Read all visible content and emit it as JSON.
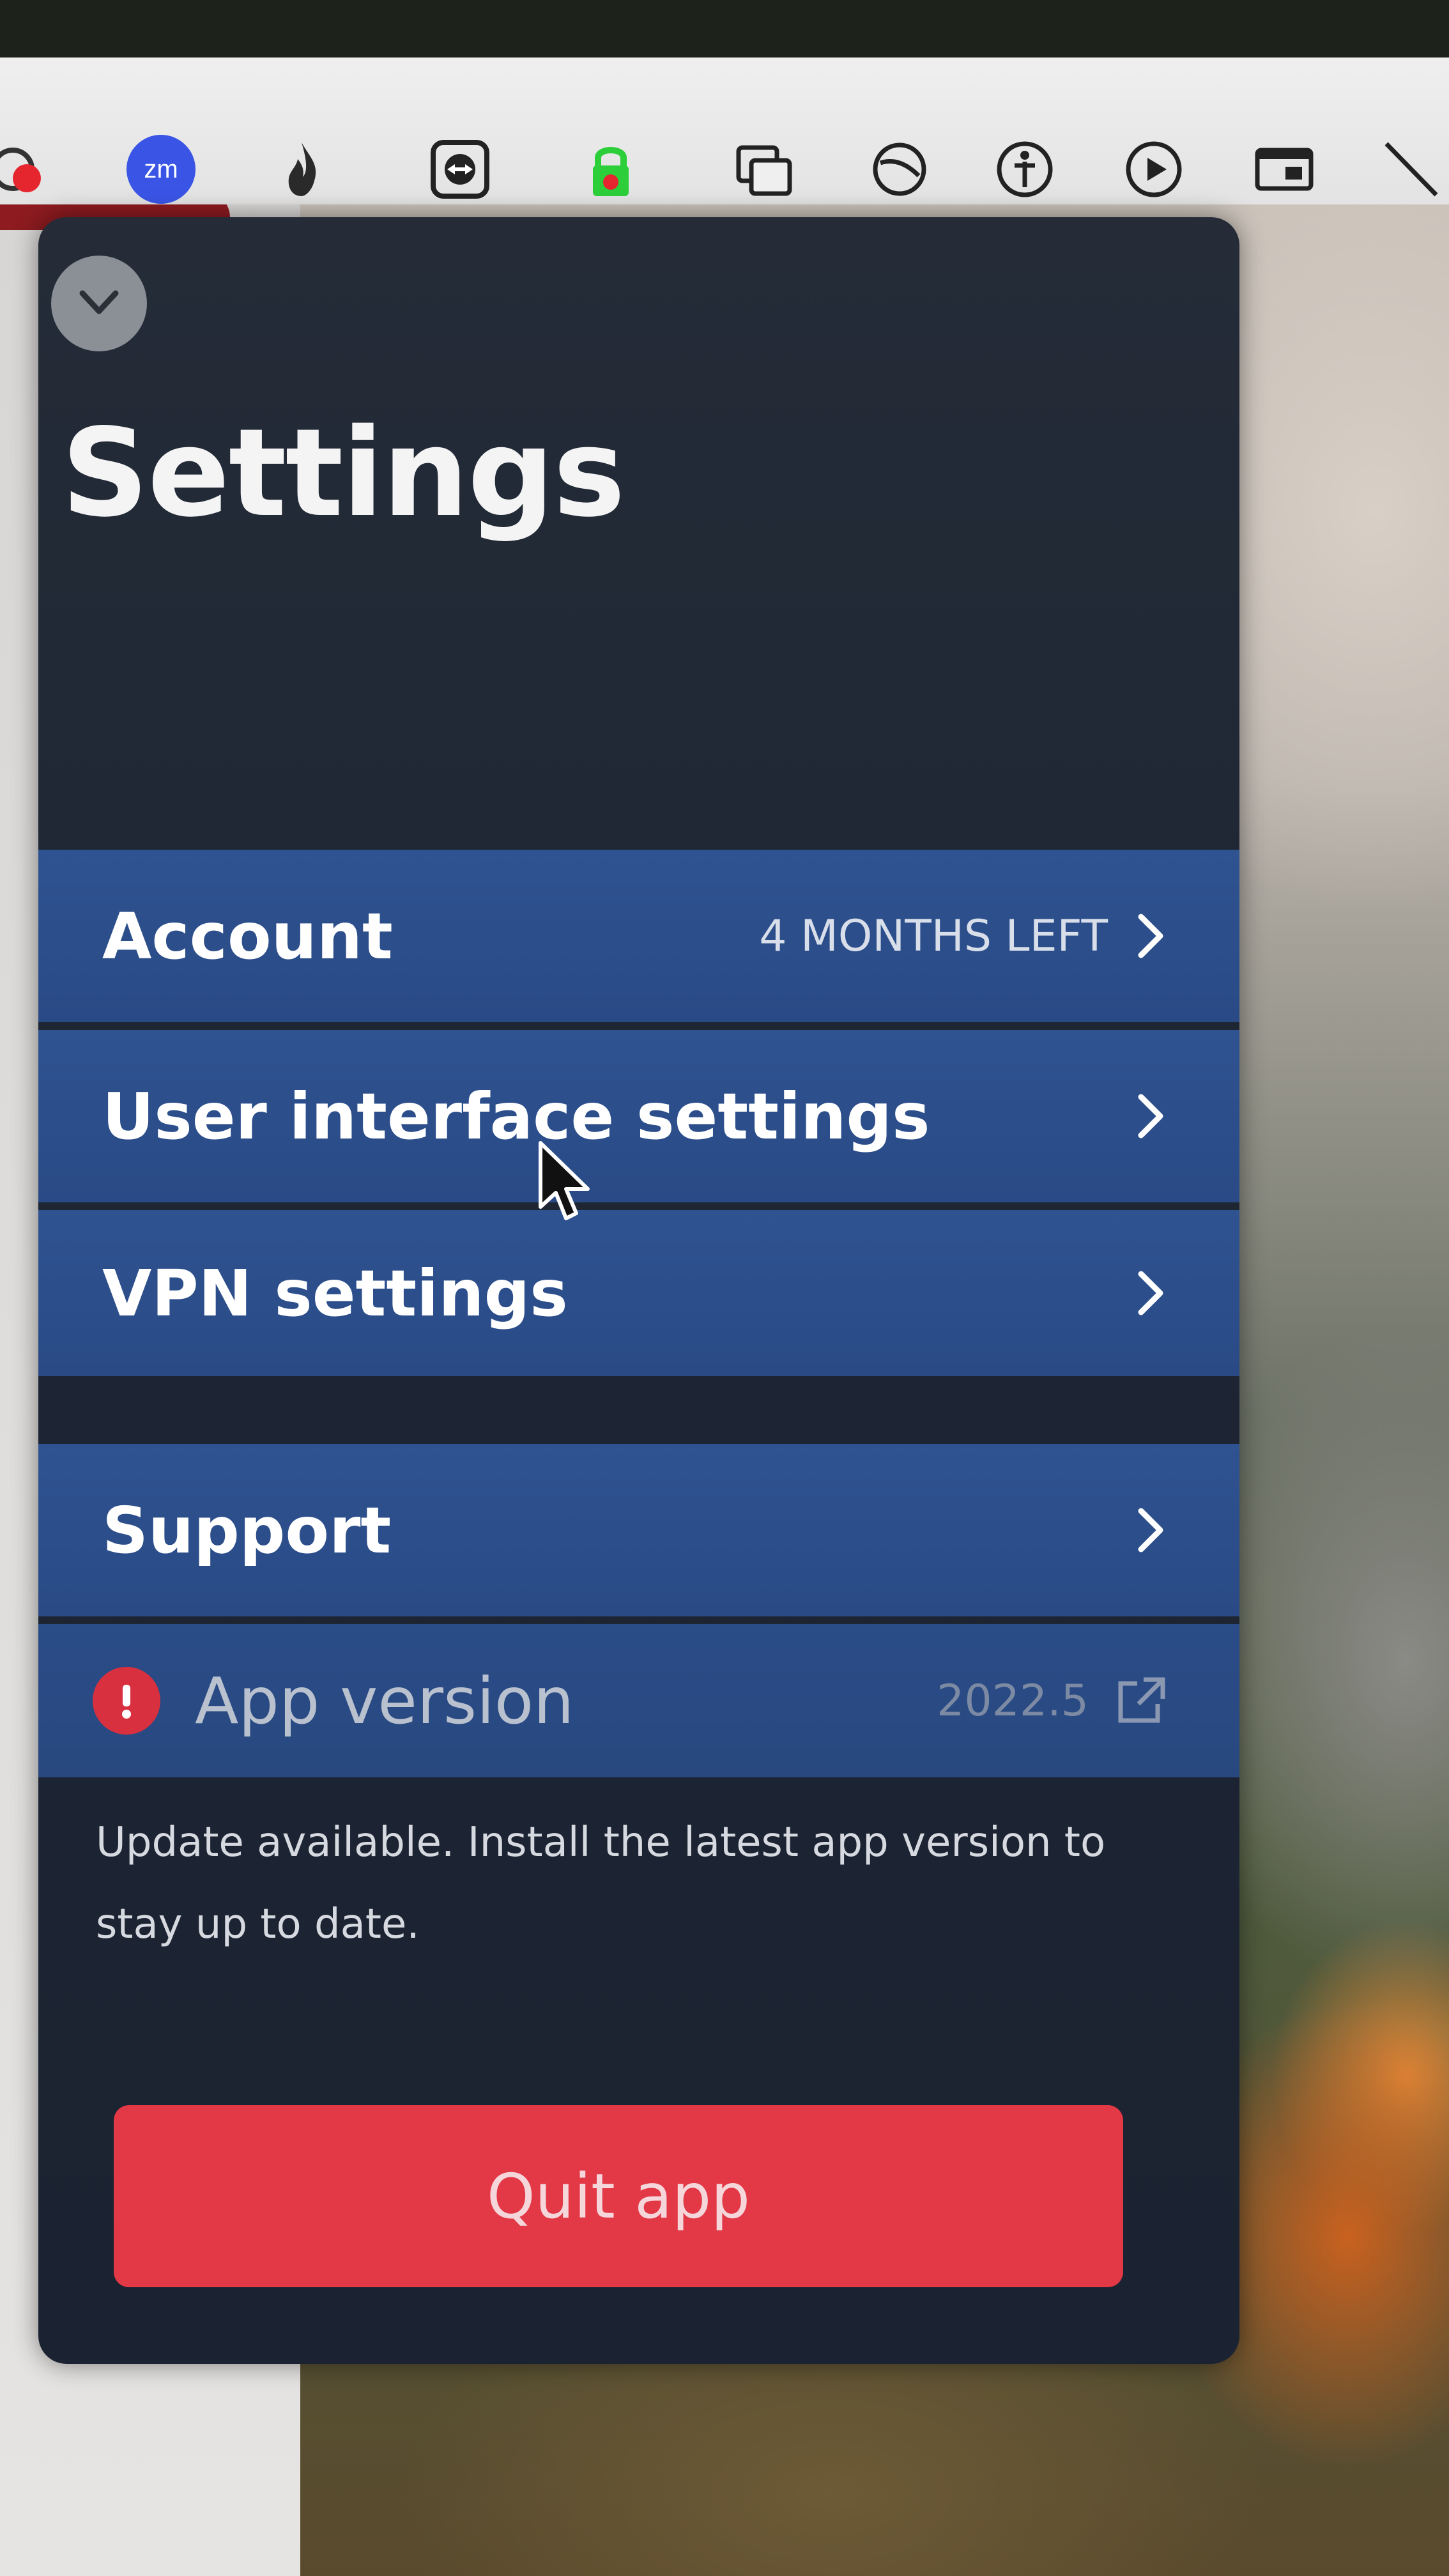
{
  "menubar": {
    "icons": [
      "camera-icon",
      "zoom-icon",
      "fire-icon",
      "teamviewer-icon",
      "vpn-lock-icon",
      "window-switcher-icon",
      "focus-icon",
      "accessibility-icon",
      "play-icon",
      "screen-icon",
      "pen-icon"
    ],
    "zoom_badge_text": "zm"
  },
  "panel": {
    "title": "Settings",
    "collapse_icon": "chevron-down-icon"
  },
  "rows": {
    "account": {
      "label": "Account",
      "meta": "4 MONTHS LEFT"
    },
    "user_interface": {
      "label": "User interface settings"
    },
    "vpn": {
      "label": "VPN settings"
    },
    "support": {
      "label": "Support"
    },
    "app_version": {
      "label": "App version",
      "meta": "2022.5",
      "alert_icon": "alert-icon",
      "link_icon": "external-link-icon"
    }
  },
  "update_note": "Update available. Install the latest app version to stay up to date.",
  "quit_button": "Quit app",
  "colors": {
    "panel_bg": "#1e2634",
    "row_bg": "#2f5391",
    "quit_bg": "#e33846",
    "alert": "#d9303f"
  }
}
